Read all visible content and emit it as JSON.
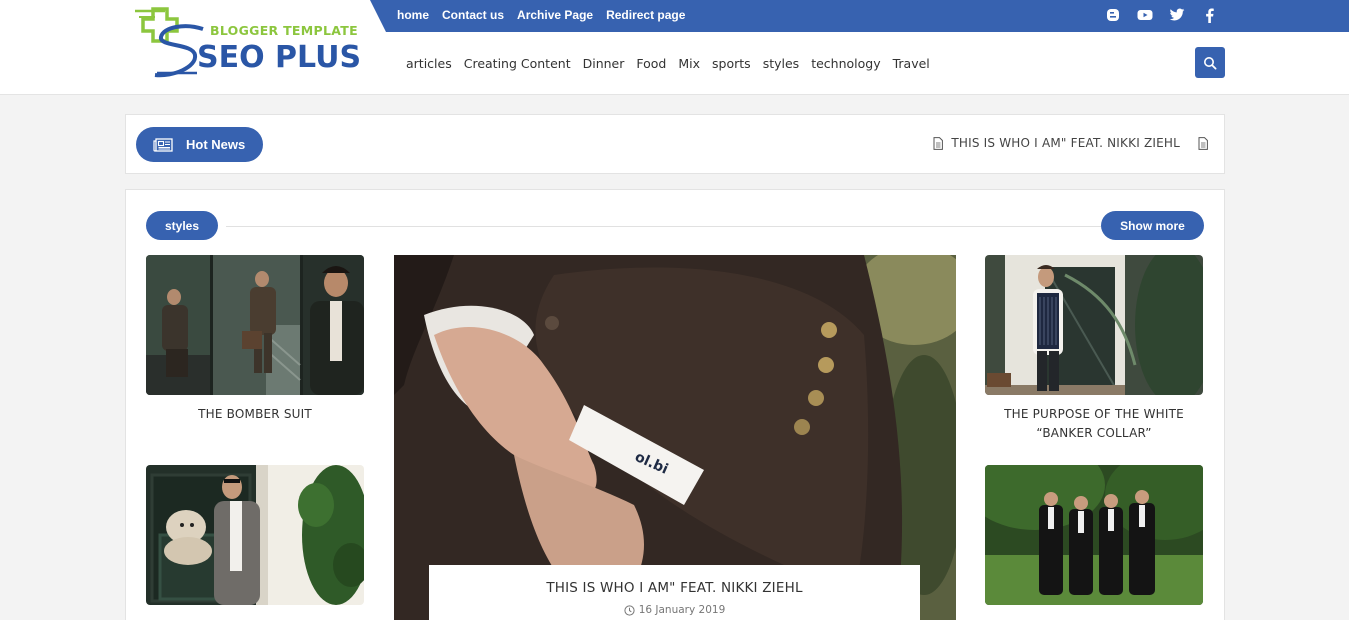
{
  "brand": {
    "top_text": "BLOGGER TEMPLATE",
    "main_text": "SEO PLUS",
    "color_primary": "#3762b0",
    "color_accent": "#8cc63e"
  },
  "top_nav": [
    "home",
    "Contact us",
    "Archive Page",
    "Redirect page"
  ],
  "social_icons": [
    "blogger-icon",
    "youtube-icon",
    "twitter-icon",
    "facebook-icon"
  ],
  "main_nav": [
    "articles",
    "Creating Content",
    "Dinner",
    "Food",
    "Mix",
    "sports",
    "styles",
    "technology",
    "Travel"
  ],
  "search_icon": "search-icon",
  "ticker": {
    "label": "Hot News",
    "item": "THIS IS WHO I AM\" FEAT. NIKKI ZIEHL"
  },
  "section": {
    "label": "styles",
    "show_more": "Show more"
  },
  "posts": {
    "left_top": "THE BOMBER SUIT",
    "left_bottom": "",
    "right_top": "THE PURPOSE OF THE WHITE “BANKER COLLAR”",
    "right_bottom": "",
    "feature_title": "THIS IS WHO I AM\" FEAT. NIKKI ZIEHL",
    "feature_date": "16 January 2019"
  }
}
